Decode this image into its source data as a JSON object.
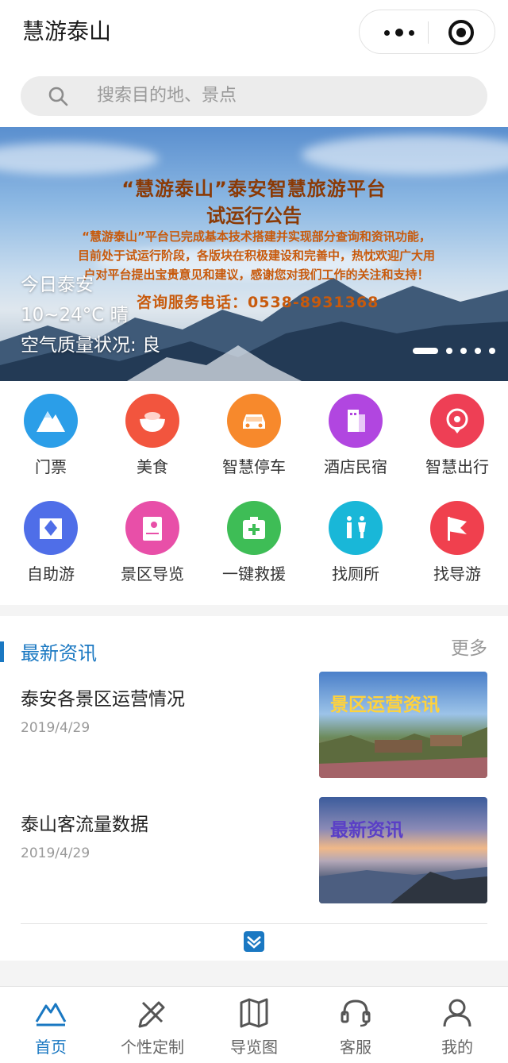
{
  "app": {
    "title": "慧游泰山"
  },
  "search": {
    "placeholder": "搜索目的地、景点"
  },
  "banner": {
    "headline_line1": "“慧游泰山”泰安智慧旅游平台",
    "headline_line2": "试运行公告",
    "body_line1": "“慧游泰山”平台已完成基本技术搭建并实现部分查询和资讯功能，",
    "body_line2": "目前处于试运行阶段，各版块在积极建设和完善中，热忱欢迎广大用",
    "body_line3": "户对平台提出宝贵意见和建议，感谢您对我们工作的关注和支持！",
    "hotline": "咨询服务电话：0538-8931368",
    "weather": {
      "city": "今日泰安",
      "temp": "10~24°C 晴",
      "air": "空气质量状况: 良"
    },
    "slide_count": 5,
    "active_slide": 1
  },
  "services": [
    {
      "label": "门票",
      "icon": "mountain-icon",
      "color": "#2b9ee8"
    },
    {
      "label": "美食",
      "icon": "food-bowl-icon",
      "color": "#f2553e"
    },
    {
      "label": "智慧停车",
      "icon": "car-icon",
      "color": "#f7892c"
    },
    {
      "label": "酒店民宿",
      "icon": "hotel-building-icon",
      "color": "#b146e0"
    },
    {
      "label": "智慧出行",
      "icon": "location-pin-icon",
      "color": "#ee3f55"
    },
    {
      "label": "自助游",
      "icon": "self-tour-icon",
      "color": "#4f6ee8"
    },
    {
      "label": "景区导览",
      "icon": "map-guide-icon",
      "color": "#e84fa8"
    },
    {
      "label": "一键救援",
      "icon": "first-aid-icon",
      "color": "#3ebd56"
    },
    {
      "label": "找厕所",
      "icon": "restroom-icon",
      "color": "#19b7d8"
    },
    {
      "label": "找导游",
      "icon": "flag-icon",
      "color": "#f0404e"
    }
  ],
  "news": {
    "section_title": "最新资讯",
    "more_label": "更多",
    "items": [
      {
        "headline": "泰安各景区运营情况",
        "date": "2019/4/29",
        "thumb_text": "景区运营资讯"
      },
      {
        "headline": "泰山客流量数据",
        "date": "2019/4/29",
        "thumb_text": "最新资讯"
      }
    ]
  },
  "tabbar": {
    "items": [
      {
        "label": "首页",
        "icon": "home-mountain-icon",
        "active": true
      },
      {
        "label": "个性定制",
        "icon": "customize-icon",
        "active": false
      },
      {
        "label": "导览图",
        "icon": "map-icon",
        "active": false
      },
      {
        "label": "客服",
        "icon": "headset-icon",
        "active": false
      },
      {
        "label": "我的",
        "icon": "user-icon",
        "active": false
      }
    ]
  },
  "colors": {
    "accent": "#1a78c2",
    "banner_text": "#8a3a06",
    "divider": "#f4f4f4"
  }
}
